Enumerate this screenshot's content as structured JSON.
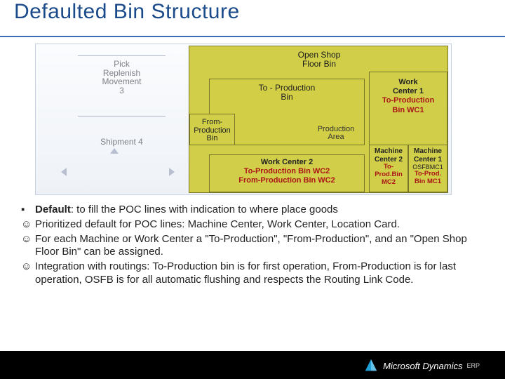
{
  "title": "Defaulted Bin Structure",
  "diagram": {
    "left": {
      "pick": "Pick\nReplenish\nMovement\n3",
      "shipment": "Shipment\n4"
    },
    "shop": {
      "osfb": "Open Shop\nFloor Bin",
      "toprod": "To - Production\nBin",
      "prodarea": "Production\nArea",
      "fromprod": "From-\nProduction\nBin",
      "wc1_head": "Work\nCenter 1",
      "wc1_red": "To-Production\nBin WC1",
      "wc2_head": "Work Center 2",
      "wc2_red": "To-Production Bin WC2\nFrom-Production Bin WC2",
      "mc2_head": "Machine\nCenter 2",
      "mc2_red": "To-\nProd.Bin\nMC2",
      "mc1_head": "Machine\nCenter 1",
      "mc1_code": "OSFBMC1",
      "mc1_red": "To-Prod.\nBin MC1"
    }
  },
  "bullets": {
    "line1a": "Default",
    "line1b": ": to fill the POC lines with indication to where place goods",
    "line2": "Prioritized default for POC lines: Machine Center, Work Center, Location Card.",
    "line3": "For each Machine or Work Center a \"To-Production\", \"From-Production\", and an \"Open Shop Floor Bin\" can be assigned.",
    "line4": "Integration with routings: To-Production bin is for first operation, From-Production is for last operation, OSFB is for all automatic flushing and respects the Routing Link Code."
  },
  "footer": {
    "brand": "Microsoft Dynamics",
    "erp": "ERP"
  }
}
